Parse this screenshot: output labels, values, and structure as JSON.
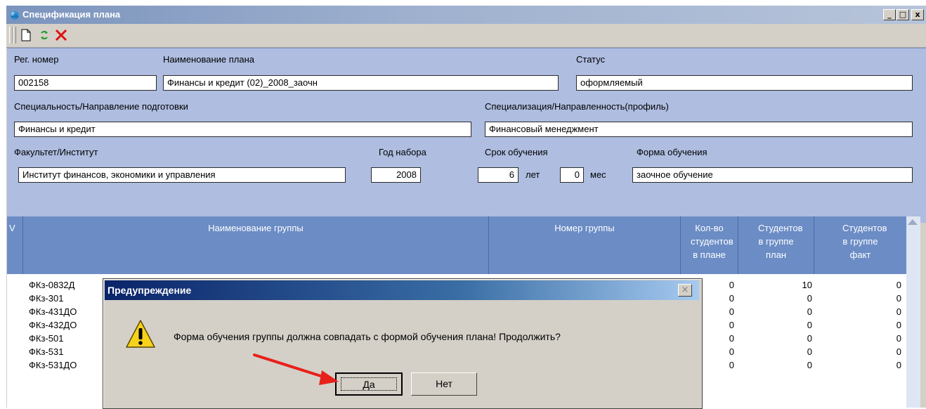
{
  "window": {
    "title": "Спецификация плана",
    "controls": [
      "minimize-icon",
      "maximize-icon",
      "close-icon"
    ]
  },
  "toolbar": {
    "icons": [
      "new-document-icon",
      "refresh-icon",
      "delete-icon"
    ]
  },
  "form": {
    "reg_number": {
      "label": "Рег. номер",
      "value": "002158"
    },
    "plan_name": {
      "label": "Наименование плана",
      "value": "Финансы и кредит (02)_2008_заочн"
    },
    "status": {
      "label": "Статус",
      "value": "оформляемый"
    },
    "specialty": {
      "label": "Специальность/Направление подготовки",
      "value": "Финансы и кредит"
    },
    "specialization": {
      "label": "Специализация/Направленность(профиль)",
      "value": "Финансовый менеджмент"
    },
    "faculty": {
      "label": "Факультет/Институт",
      "value": "Институт финансов, экономики и управления"
    },
    "enroll_year": {
      "label": "Год набора",
      "value": "2008"
    },
    "duration": {
      "label": "Срок обучения",
      "years": "6",
      "years_unit": "лет",
      "months": "0",
      "months_unit": "мес"
    },
    "study_form": {
      "label": "Форма обучения",
      "value": "заочное обучение"
    }
  },
  "grid": {
    "columns": [
      "V",
      "Наименование группы",
      "Номер группы",
      "Кол-во студентов в плане",
      "Студентов в группе план",
      "Студентов в группе факт"
    ],
    "rows": [
      {
        "name": "ФКз-0832Д",
        "plan_count": "0",
        "group_plan": "10",
        "group_fact": "0"
      },
      {
        "name": "ФКз-301",
        "plan_count": "0",
        "group_plan": "0",
        "group_fact": "0"
      },
      {
        "name": "ФКз-431ДО",
        "plan_count": "0",
        "group_plan": "0",
        "group_fact": "0"
      },
      {
        "name": "ФКз-432ДО",
        "plan_count": "0",
        "group_plan": "0",
        "group_fact": "0"
      },
      {
        "name": "ФКз-501",
        "plan_count": "0",
        "group_plan": "0",
        "group_fact": "0"
      },
      {
        "name": "ФКз-531",
        "plan_count": "0",
        "group_plan": "0",
        "group_fact": "0"
      },
      {
        "name": "ФКз-531ДО",
        "plan_count": "0",
        "group_plan": "0",
        "group_fact": "0"
      }
    ]
  },
  "dialog": {
    "title": "Предупреждение",
    "message": "Форма обучения группы должна совпадать с формой обучения плана! Продолжить?",
    "yes_label": "Да",
    "no_label": "Нет",
    "icon": "warning-icon"
  },
  "annotation": {
    "arrow_color": "#e8201a"
  },
  "colors": {
    "form_background": "#aebde0",
    "grid_header": "#6b8cc5",
    "dialog_title": "#0a246a"
  }
}
